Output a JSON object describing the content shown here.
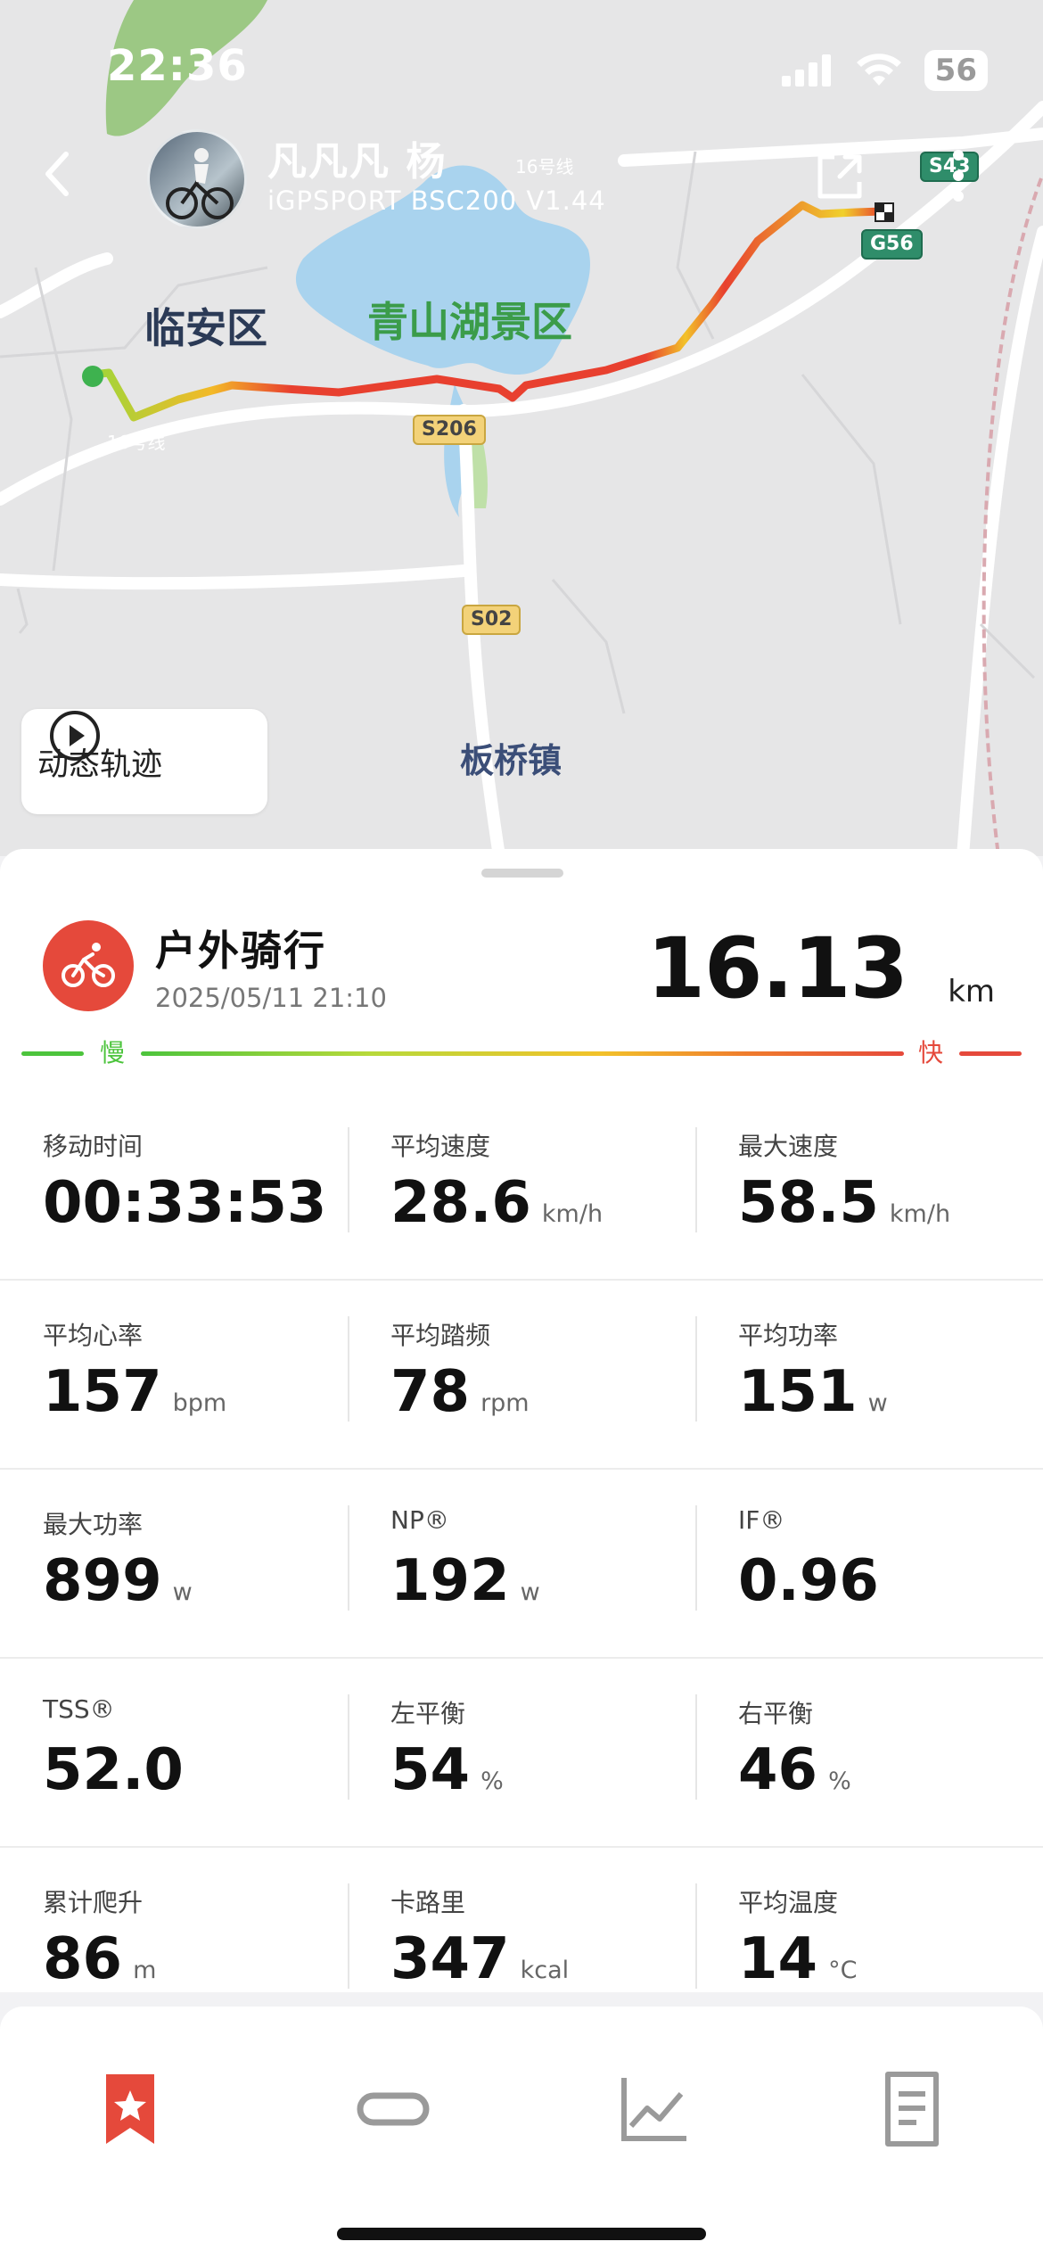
{
  "status_bar": {
    "time": "22:36",
    "battery": "56"
  },
  "header": {
    "user_name": "凡凡凡 杨",
    "device": "iGPSPORT BSC200 V1.44"
  },
  "map": {
    "labels": {
      "district": "临安区",
      "lake": "青山湖景区",
      "town": "板桥镇"
    },
    "roads": {
      "r1": "16号线",
      "r2": "16号线",
      "s206": "S206",
      "s02": "S02",
      "g56": "G56",
      "s43": "S43"
    },
    "replay_label": "动态轨迹"
  },
  "activity": {
    "type": "户外骑行",
    "datetime": "2025/05/11 21:10",
    "distance": "16.13",
    "distance_unit": "km",
    "slow_label": "慢",
    "fast_label": "快"
  },
  "stats": [
    [
      {
        "label": "移动时间",
        "value": "00:33:53",
        "unit": ""
      },
      {
        "label": "平均速度",
        "value": "28.6",
        "unit": "km/h"
      },
      {
        "label": "最大速度",
        "value": "58.5",
        "unit": "km/h"
      }
    ],
    [
      {
        "label": "平均心率",
        "value": "157",
        "unit": "bpm"
      },
      {
        "label": "平均踏频",
        "value": "78",
        "unit": "rpm"
      },
      {
        "label": "平均功率",
        "value": "151",
        "unit": "w"
      }
    ],
    [
      {
        "label": "最大功率",
        "value": "899",
        "unit": "w"
      },
      {
        "label": "NP®",
        "value": "192",
        "unit": "w"
      },
      {
        "label": "IF®",
        "value": "0.96",
        "unit": ""
      }
    ],
    [
      {
        "label": "TSS®",
        "value": "52.0",
        "unit": ""
      },
      {
        "label": "左平衡",
        "value": "54",
        "unit": "%"
      },
      {
        "label": "右平衡",
        "value": "46",
        "unit": "%"
      }
    ],
    [
      {
        "label": "累计爬升",
        "value": "86",
        "unit": "m"
      },
      {
        "label": "卡路里",
        "value": "347",
        "unit": "kcal"
      },
      {
        "label": "平均温度",
        "value": "14",
        "unit": "°C"
      }
    ]
  ],
  "colors": {
    "accent": "#e5493b",
    "slow": "#4cc43c",
    "fast": "#e5493b"
  },
  "tabs": [
    {
      "icon": "bookmark-star-icon",
      "active": true
    },
    {
      "icon": "track-loop-icon",
      "active": false
    },
    {
      "icon": "line-chart-icon",
      "active": false
    },
    {
      "icon": "document-icon",
      "active": false
    }
  ]
}
